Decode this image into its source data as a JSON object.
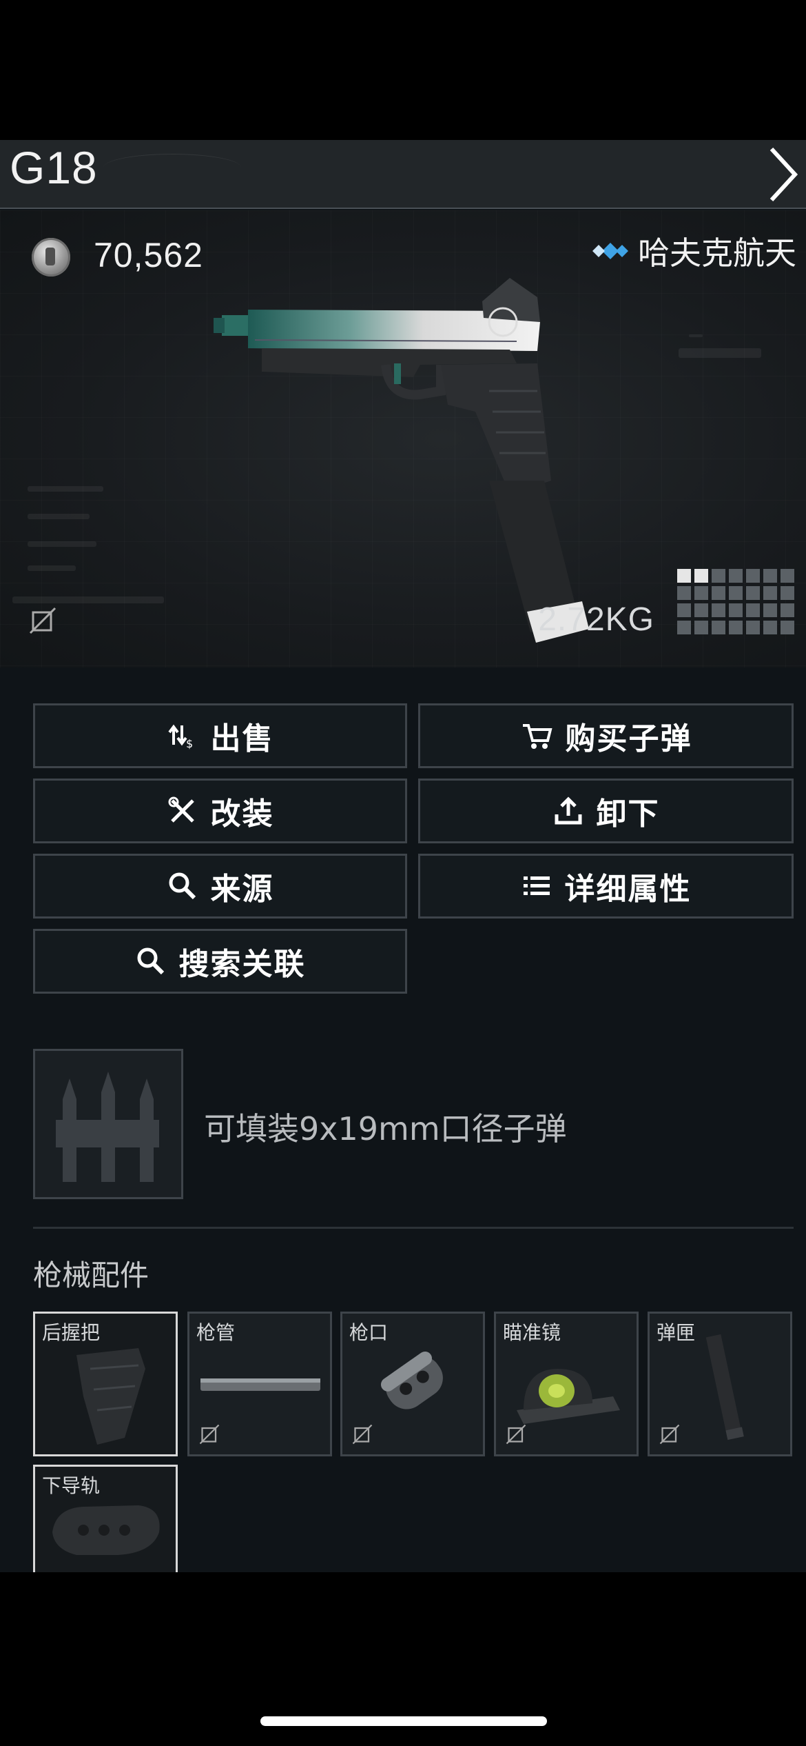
{
  "header": {
    "title": "G18"
  },
  "showcase": {
    "price": "70,562",
    "brand": "哈夫克航天",
    "weight": "2.72KG",
    "size_grid_filled": 2
  },
  "actions": [
    {
      "label": "出售",
      "icon": "sell-icon"
    },
    {
      "label": "购买子弹",
      "icon": "cart-icon"
    },
    {
      "label": "改装",
      "icon": "tools-icon"
    },
    {
      "label": "卸下",
      "icon": "upload-icon"
    },
    {
      "label": "来源",
      "icon": "search-icon"
    },
    {
      "label": "详细属性",
      "icon": "list-icon"
    },
    {
      "label": "搜索关联",
      "icon": "search-icon"
    }
  ],
  "ammo": {
    "text": "可填装9x19mm口径子弹"
  },
  "attachments": {
    "title": "枪械配件",
    "slots": [
      {
        "label": "后握把",
        "filled": true
      },
      {
        "label": "枪管",
        "filled": false
      },
      {
        "label": "枪口",
        "filled": false
      },
      {
        "label": "瞄准镜",
        "filled": false
      },
      {
        "label": "弹匣",
        "filled": false
      },
      {
        "label": "下导轨",
        "filled": true
      }
    ]
  },
  "colors": {
    "accent_blue": "#3fa3e6",
    "panel_bg": "#0f1418",
    "border": "#3e444a"
  }
}
